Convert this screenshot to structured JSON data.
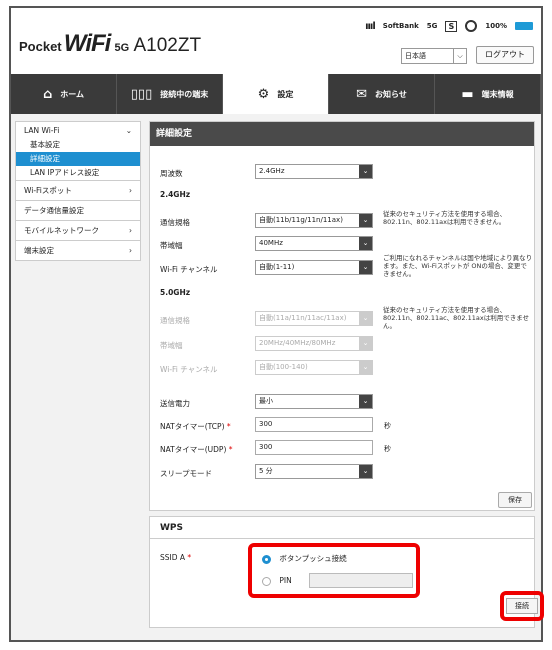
{
  "header": {
    "logo_pocket": "Pocket",
    "logo_wifi": "WiFi",
    "logo_5g": "5G",
    "model": "A102ZT",
    "signal": "ıııl",
    "carrier": "SoftBank",
    "network": "5G",
    "s_mark": "S",
    "battery": "100%",
    "language": "日本語",
    "logout": "ログアウト"
  },
  "nav": {
    "home": "ホーム",
    "devices": "接続中の端末",
    "settings": "設定",
    "messages": "お知らせ",
    "device_info": "端末情報"
  },
  "sidebar": {
    "lan_wifi": "LAN Wi-Fi",
    "basic": "基本設定",
    "advanced": "詳細設定",
    "lan_ip": "LAN IPアドレス設定",
    "wifi_spot": "Wi-Fiスポット",
    "data_usage": "データ通信量設定",
    "mobile_network": "モバイルネットワーク",
    "device_settings": "端末設定"
  },
  "panel": {
    "title": "詳細設定",
    "frequency_label": "周波数",
    "frequency_value": "2.4GHz",
    "section_24": "2.4GHz",
    "standard_label": "通信規格",
    "standard_24": "自動(11b/11g/11n/11ax)",
    "standard_note_24": "従来のセキュリティ方法を使用する場合、802.11n、802.11axは利用できません。",
    "bandwidth_label": "帯域幅",
    "bandwidth_24": "40MHz",
    "channel_label": "Wi-Fi チャンネル",
    "channel_24": "自動(1-11)",
    "channel_note_24": "ご利用になれるチャンネルは国や地域により異なります。また、Wi-Fiスポットが ONの場合、変更できません。",
    "section_5": "5.0GHz",
    "standard_5": "自動(11a/11n/11ac/11ax)",
    "standard_note_5": "従来のセキュリティ方法を使用する場合、802.11n、802.11ac、802.11axは利用できません。",
    "bandwidth_5": "20MHz/40MHz/80MHz",
    "channel_5": "自動(100-140)",
    "tx_power_label": "送信電力",
    "tx_power_value": "最小",
    "nat_tcp_label": "NATタイマー(TCP)",
    "nat_tcp_value": "300",
    "nat_udp_label": "NATタイマー(UDP)",
    "nat_udp_value": "300",
    "seconds": "秒",
    "sleep_label": "スリープモード",
    "sleep_value": "5 分",
    "required": "*",
    "save": "保存"
  },
  "wps": {
    "title": "WPS",
    "ssid_label": "SSID A",
    "push_button": "ボタンプッシュ接続",
    "pin": "PIN",
    "connect": "接続"
  }
}
